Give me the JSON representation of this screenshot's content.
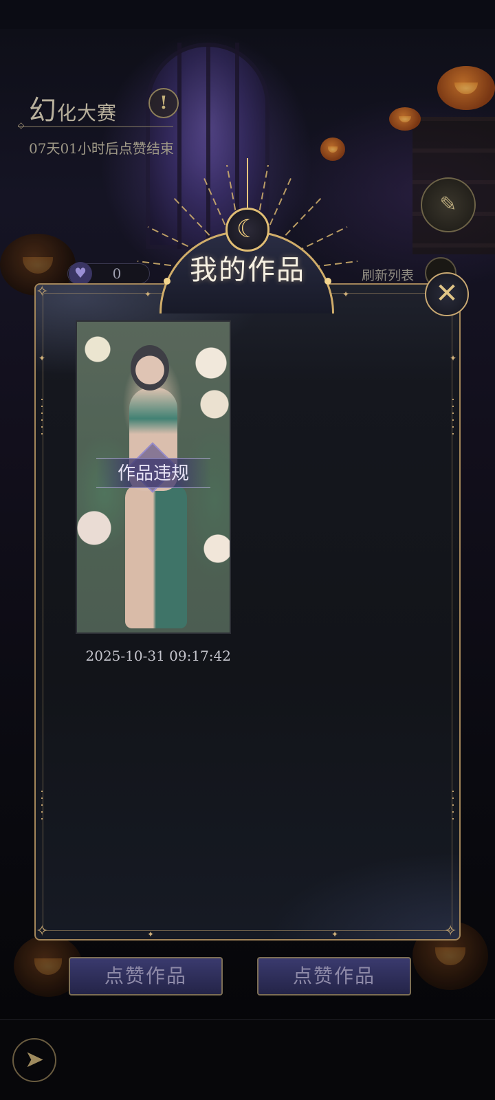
{
  "background": {
    "contest_title_big": "幻",
    "contest_title_rest": "化大赛",
    "info_icon": "!",
    "countdown": "07天01小时后点赞结束",
    "likes_count": "0",
    "refresh_label": "刷新列表"
  },
  "modal": {
    "title": "我的作品",
    "close_icon": "✕",
    "works": [
      {
        "status_label": "作品违规",
        "date": "2025-10-31 09:17:42"
      }
    ]
  },
  "bottom": {
    "like_buttons": [
      "点赞作品",
      "点赞作品"
    ]
  },
  "icons": {
    "heart": "♥",
    "moon": "☾",
    "back": "➤",
    "quill": "✎"
  },
  "colors": {
    "gold": "#d0ad6a",
    "modal_bg": "#15171e",
    "like_button": "#2c2c58"
  }
}
